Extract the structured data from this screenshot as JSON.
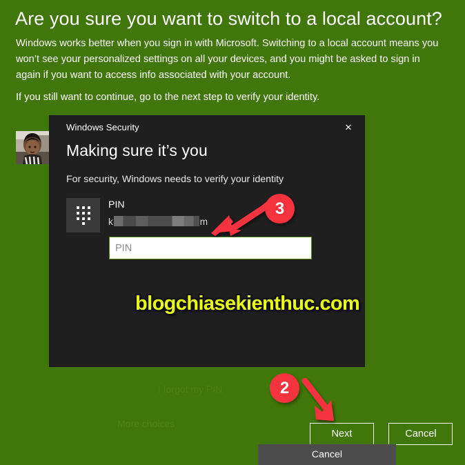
{
  "page": {
    "title": "Are you sure you want to switch to a local account?",
    "paragraph1": "Windows works better when you sign in with Microsoft. Switching to a local account means you won’t see your personalized settings on all your devices, and you might be asked to sign in again if you want to access info associated with your account.",
    "paragraph2": "If you still want to continue, go to the next step to verify your identity.",
    "avatar_alt": "user-profile-photo",
    "buttons": {
      "next": "Next",
      "cancel": "Cancel"
    },
    "background_color": "#41760a",
    "text_color": "#ffffff"
  },
  "dialog": {
    "app_title": "Windows Security",
    "close_icon": "✕",
    "heading": "Making sure it’s you",
    "subtext": "For security, Windows needs to verify your identity",
    "credential": {
      "icon": "pin-keypad-icon",
      "label": "PIN",
      "account_prefix": "k",
      "account_suffix": "m",
      "account_redacted": true
    },
    "pin_field": {
      "value": "",
      "placeholder": "PIN",
      "border_color": "#57890e"
    },
    "forgot_link": "I forgot my PIN",
    "more_choices": "More choices",
    "cancel_button": "Cancel",
    "background_color": "#1f1f1f"
  },
  "watermark": {
    "text": "blogchiasekienthuc.com",
    "color": "#e9ff14"
  },
  "annotations": {
    "accent_color": "#f5333f",
    "steps": [
      {
        "number": "3",
        "target": "pin-input",
        "direction": "down-left"
      },
      {
        "number": "2",
        "target": "next-button",
        "direction": "down-right"
      }
    ]
  }
}
